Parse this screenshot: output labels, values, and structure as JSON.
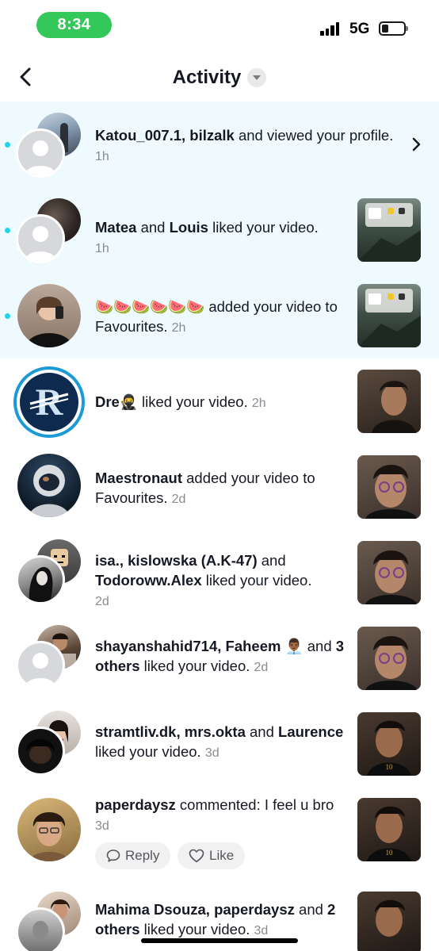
{
  "status_bar": {
    "time": "8:34",
    "network": "5G"
  },
  "header": {
    "title": "Activity"
  },
  "notifications": [
    {
      "names": "Katou_007.1, bilzalk",
      "action": " and  viewed your profile.",
      "time": "1h"
    },
    {
      "name1": "Matea",
      "and": " and ",
      "name2": "Louis",
      "action": " liked your video.",
      "time": "1h"
    },
    {
      "emojis": "🍉🍉🍉🍉🍉🍉",
      "action": " added your video to Favourites.",
      "time": "2h"
    },
    {
      "name": "Dre🥷",
      "action": " liked your video.",
      "time": "2h"
    },
    {
      "name": "Maestronaut",
      "action": " added your video to Favourites.",
      "time": "2d"
    },
    {
      "names": "isa., kislowska (A.K-47)",
      "and": " and ",
      "name3": "Todoroww.Alex",
      "action": " liked your video.",
      "time": "2d"
    },
    {
      "names": "shayanshahid714, Faheem 👨🏾‍💼",
      "and": " and ",
      "others": "3 others",
      "action": " liked your video.",
      "time": "2d"
    },
    {
      "names": "stramtliv.dk, mrs.okta",
      "and": " and ",
      "name3": "Laurence",
      "action": " liked your video.",
      "time": "3d"
    },
    {
      "name": "paperdaysz",
      "action": " commented: I feel u bro",
      "time": "3d",
      "reply_label": "Reply",
      "like_label": "Like"
    },
    {
      "names": "Mahima Dsouza, paperdaysz",
      "and": " and ",
      "others": "2 others",
      "action": " liked your video.",
      "time": "3d"
    }
  ],
  "colors": {
    "unread_bg": "#eefafd",
    "unread_dot": "#20d5ec",
    "status_pill": "#34c759"
  }
}
